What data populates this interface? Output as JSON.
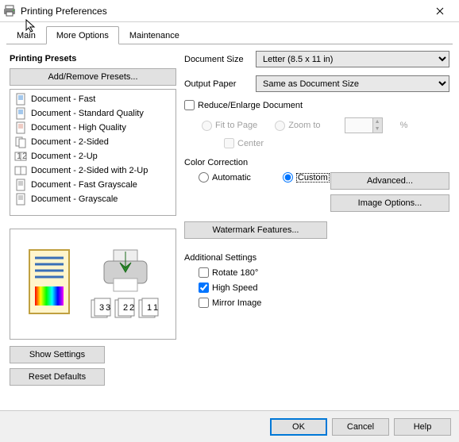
{
  "window": {
    "title": "Printing Preferences"
  },
  "tabs": {
    "main": "Main",
    "more_options": "More Options",
    "maintenance": "Maintenance"
  },
  "left": {
    "presets_header": "Printing Presets",
    "add_remove": "Add/Remove Presets...",
    "presets": [
      "Document - Fast",
      "Document - Standard Quality",
      "Document - High Quality",
      "Document - 2-Sided",
      "Document - 2-Up",
      "Document - 2-Sided with 2-Up",
      "Document - Fast Grayscale",
      "Document - Grayscale"
    ],
    "show_settings": "Show Settings",
    "reset_defaults": "Reset Defaults"
  },
  "right": {
    "doc_size_label": "Document Size",
    "doc_size_value": "Letter (8.5 x 11 in)",
    "output_paper_label": "Output Paper",
    "output_paper_value": "Same as Document Size",
    "reduce_enlarge": "Reduce/Enlarge Document",
    "fit_to_page": "Fit to Page",
    "zoom_to": "Zoom to",
    "percent": "%",
    "center": "Center",
    "color_correction": "Color Correction",
    "automatic": "Automatic",
    "custom": "Custom",
    "advanced": "Advanced...",
    "image_options": "Image Options...",
    "watermark": "Watermark Features...",
    "additional": "Additional Settings",
    "rotate": "Rotate 180°",
    "high_speed": "High Speed",
    "mirror": "Mirror Image"
  },
  "footer": {
    "ok": "OK",
    "cancel": "Cancel",
    "help": "Help"
  }
}
